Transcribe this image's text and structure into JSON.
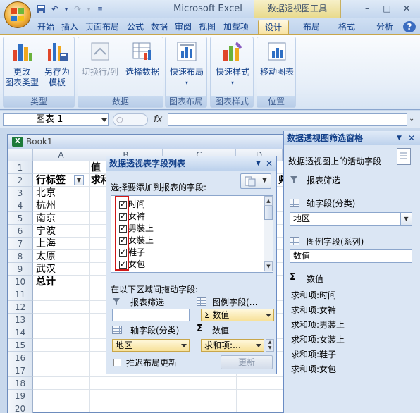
{
  "window": {
    "app_title": "Microsoft Excel",
    "context_tab_title": "数据透视图工具",
    "controls": [
      "–",
      "□",
      "✕"
    ]
  },
  "ribbon_tabs": [
    {
      "label": "开始"
    },
    {
      "label": "插入"
    },
    {
      "label": "页面布局"
    },
    {
      "label": "公式"
    },
    {
      "label": "数据"
    },
    {
      "label": "审阅"
    },
    {
      "label": "视图"
    },
    {
      "label": "加载项"
    },
    {
      "label": "设计"
    },
    {
      "label": "布局"
    },
    {
      "label": "格式"
    },
    {
      "label": "分析"
    }
  ],
  "ribbon": {
    "type_group": {
      "label": "类型",
      "change_type": "更改\n图表类型",
      "save_template": "另存为\n模板"
    },
    "data_group": {
      "label": "数据",
      "switch_row_col": "切换行/列",
      "select_data": "选择数据"
    },
    "layout_group": {
      "label": "图表布局",
      "quick_layout": "快速布局"
    },
    "style_group": {
      "label": "图表样式",
      "quick_style": "快速样式"
    },
    "location_group": {
      "label": "位置",
      "move_chart": "移动图表"
    }
  },
  "formula_bar": {
    "name_box": "图表 1",
    "zoom_hint": "○",
    "fx": "fx"
  },
  "workbook": {
    "title": "Book1",
    "columns": [
      "A",
      "B",
      "C",
      "D"
    ],
    "rows": [
      "1",
      "2",
      "3",
      "4",
      "5",
      "6",
      "7",
      "8",
      "9",
      "10",
      "11",
      "12",
      "13",
      "14",
      "15",
      "16",
      "17",
      "18",
      "19",
      "20"
    ],
    "cells": {
      "b1": "值",
      "a2": "行标签",
      "b2": "求和",
      "a3": "北京",
      "a4": "杭州",
      "a5": "南京",
      "a6": "宁波",
      "a7": "上海",
      "a8": "太原",
      "a9": "武汉",
      "a10": "总计",
      "e2": "県"
    }
  },
  "pivot_field_list": {
    "title": "数据透视表字段列表",
    "choose_label": "选择要添加到报表的字段:",
    "fields": [
      {
        "label": "时间",
        "checked": true
      },
      {
        "label": "女裤",
        "checked": true
      },
      {
        "label": "男装上",
        "checked": true
      },
      {
        "label": "女装上",
        "checked": true
      },
      {
        "label": "鞋子",
        "checked": true
      },
      {
        "label": "女包",
        "checked": true
      }
    ],
    "drag_label": "在以下区域间拖动字段:",
    "report_filter_label": "报表筛选",
    "legend_fields_label": "图例字段(…",
    "axis_fields_label": "轴字段(分类)",
    "values_label": "数值",
    "legend_value": "Σ 数值",
    "axis_value": "地区",
    "values_value": "求和项:…",
    "defer_label": "推迟布局更新",
    "update_button": "更新"
  },
  "filter_pane": {
    "title": "数据透视图筛选窗格",
    "active_fields": "数据透视图上的活动字段",
    "report_filter": "报表筛选",
    "axis_fields": "轴字段(分类)",
    "axis_value": "地区",
    "legend_fields": "图例字段(系列)",
    "legend_value": "数值",
    "values_heading": "数值",
    "values": [
      "求和项:时间",
      "求和项:女裤",
      "求和项:男装上",
      "求和项:女装上",
      "求和项:鞋子",
      "求和项:女包"
    ]
  }
}
